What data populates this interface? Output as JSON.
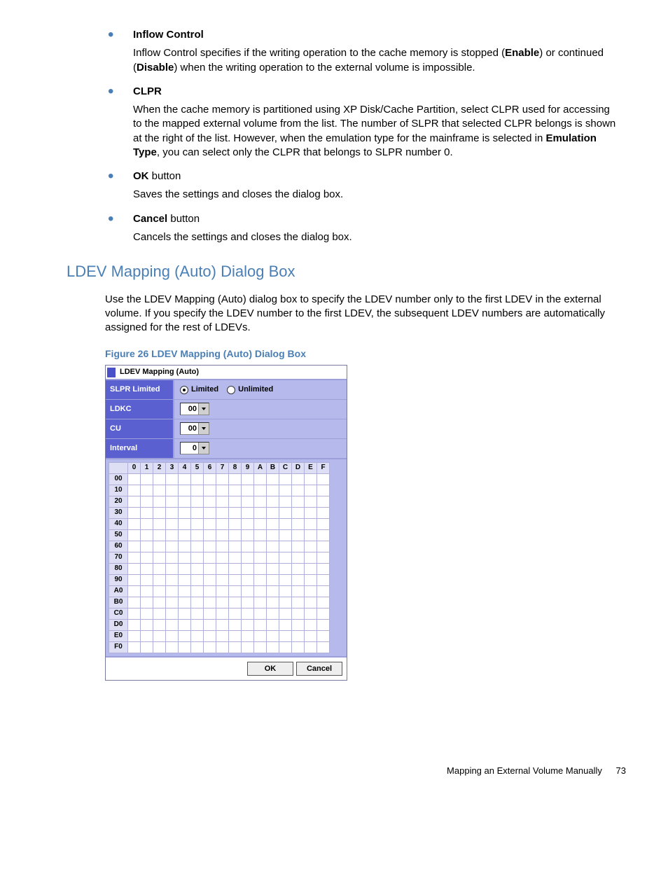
{
  "bullets": [
    {
      "title": "Inflow Control",
      "body_parts": [
        "Inflow Control specifies if the writing operation to the cache memory is stopped (",
        "Enable",
        ") or continued (",
        "Disable",
        ") when the writing operation to the external volume is impossible."
      ]
    },
    {
      "title": "CLPR",
      "body_parts": [
        "When the cache memory is partitioned using XP Disk/Cache Partition, select CLPR used for accessing to the mapped external volume from the list. The number of SLPR that selected CLPR belongs is shown at the right of the list. However, when the emulation type for the mainframe is selected in ",
        "Emulation Type",
        ", you can select only the CLPR that belongs to SLPR number 0."
      ]
    },
    {
      "title_parts": [
        "OK",
        " button"
      ],
      "body": "Saves the settings and closes the dialog box."
    },
    {
      "title_parts": [
        "Cancel",
        " button"
      ],
      "body": "Cancels the settings and closes the dialog box."
    }
  ],
  "section_heading": "LDEV Mapping (Auto) Dialog Box",
  "section_para": "Use the LDEV Mapping (Auto) dialog box to specify the LDEV number only to the first LDEV in the external volume. If you specify the LDEV number to the first LDEV, the subsequent LDEV numbers are automatically assigned for the rest of LDEVs.",
  "figure_caption": "Figure 26 LDEV Mapping (Auto) Dialog Box",
  "dialog": {
    "title": "LDEV Mapping (Auto)",
    "rows": {
      "slpr_label": "SLPR Limited",
      "limited": "Limited",
      "unlimited": "Unlimited",
      "ldkc_label": "LDKC",
      "ldkc_value": "00",
      "cu_label": "CU",
      "cu_value": "00",
      "interval_label": "Interval",
      "interval_value": "0"
    },
    "grid": {
      "cols": [
        "0",
        "1",
        "2",
        "3",
        "4",
        "5",
        "6",
        "7",
        "8",
        "9",
        "A",
        "B",
        "C",
        "D",
        "E",
        "F"
      ],
      "rows": [
        "00",
        "10",
        "20",
        "30",
        "40",
        "50",
        "60",
        "70",
        "80",
        "90",
        "A0",
        "B0",
        "C0",
        "D0",
        "E0",
        "F0"
      ]
    },
    "ok": "OK",
    "cancel": "Cancel"
  },
  "footer": {
    "text": "Mapping an External Volume Manually",
    "page": "73"
  }
}
